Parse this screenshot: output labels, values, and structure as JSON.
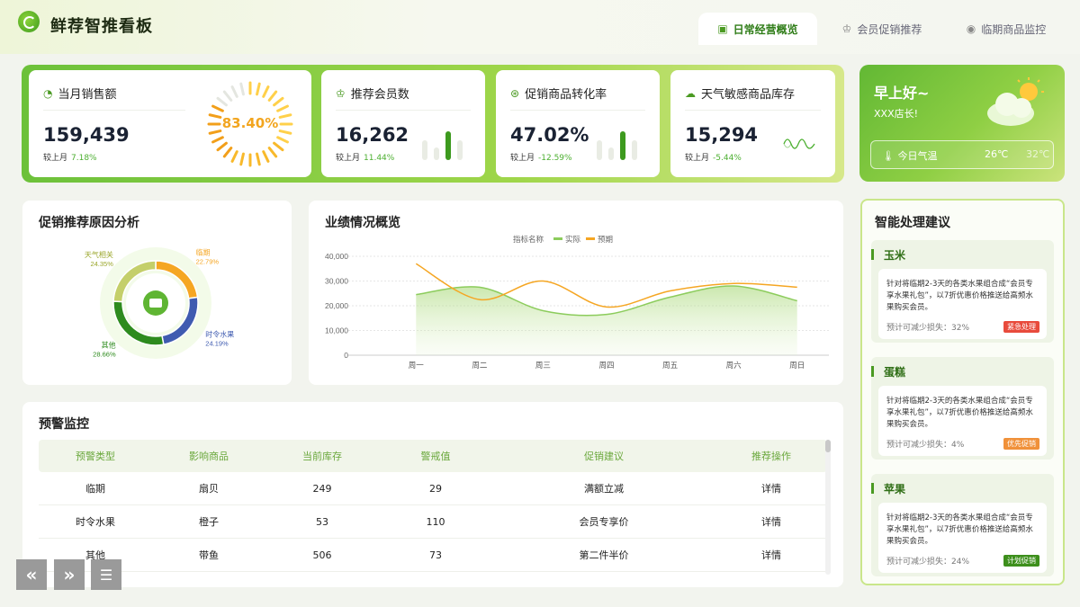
{
  "app": {
    "title": "鲜荐智推看板"
  },
  "tabs": [
    {
      "label": "日常经营概览",
      "icon": "monitor-icon"
    },
    {
      "label": "会员促销推荐",
      "icon": "crown-icon"
    },
    {
      "label": "临期商品监控",
      "icon": "location-icon"
    }
  ],
  "kpis": [
    {
      "title": "当月销售额",
      "icon": "pie-chart-icon",
      "value": "159,439",
      "compare_label": "较上月",
      "compare_value": "7.18%",
      "gauge_percent": 83.4,
      "gauge_label": "83.40%"
    },
    {
      "title": "推荐会员数",
      "icon": "crown-icon",
      "value": "16,262",
      "compare_label": "较上月",
      "compare_value": "11.44%"
    },
    {
      "title": "促销商品转化率",
      "icon": "dollar-circle-icon",
      "value": "47.02%",
      "compare_label": "较上月",
      "compare_value": "-12.59%"
    },
    {
      "title": "天气敏感商品库存",
      "icon": "cloud-icon",
      "value": "15,294",
      "compare_label": "较上月",
      "compare_value": "-5.44%"
    }
  ],
  "weather": {
    "greeting": "早上好~",
    "name": "XXX店长!",
    "today_label": "今日气温",
    "temp_low": "26℃",
    "temp_high": "32℃"
  },
  "reason_panel": {
    "title": "促销推荐原因分析"
  },
  "perf_panel": {
    "title": "业绩情况概览"
  },
  "warning_panel": {
    "title": "预警监控",
    "columns": [
      "预警类型",
      "影响商品",
      "当前库存",
      "警戒值",
      "促销建议",
      "推荐操作"
    ],
    "rows": [
      [
        "临期",
        "扇贝",
        "249",
        "29",
        "满额立减",
        "详情"
      ],
      [
        "时令水果",
        "橙子",
        "53",
        "110",
        "会员专享价",
        "详情"
      ],
      [
        "其他",
        "带鱼",
        "506",
        "73",
        "第二件半价",
        "详情"
      ]
    ]
  },
  "advice_panel": {
    "title": "智能处理建议",
    "items": [
      {
        "name": "玉米",
        "text": "针对将临期2-3天的各类水果组合成“会员专享水果礼包”，以7折优惠价格推送给高频水果购买会员。",
        "foot": "预计可减少损失：32%",
        "badge": "紧急处理",
        "badge_color": "#e84b3c"
      },
      {
        "name": "蛋糕",
        "text": "针对将临期2-3天的各类水果组合成“会员专享水果礼包”，以7折优惠价格推送给高频水果购买会员。",
        "foot": "预计可减少损失：4%",
        "badge": "优先促销",
        "badge_color": "#f0913a"
      },
      {
        "name": "苹果",
        "text": "针对将临期2-3天的各类水果组合成“会员专享水果礼包”，以7折优惠价格推送给高频水果购买会员。",
        "foot": "预计可减少损失：24%",
        "badge": "计划促销",
        "badge_color": "#3d8f1c"
      }
    ]
  },
  "colors": {
    "accent": "#4a9a22",
    "actual": "#8ccc5c",
    "forecast": "#f5a623",
    "gauge": "#f2a51f"
  },
  "chart_data": [
    {
      "type": "pie",
      "title": "",
      "categories": [
        "临期",
        "时令水果",
        "其他",
        "天气相关"
      ],
      "values": [
        22.79,
        24.19,
        28.66,
        24.35
      ],
      "labels": [
        "22.79%",
        "24.19%",
        "28.66%",
        "24.35%"
      ],
      "colors": [
        "#f5a623",
        "#3f5bb0",
        "#2e8b1e",
        "#c4cf6a"
      ]
    },
    {
      "type": "area",
      "title": "",
      "legend_title": "指标名称",
      "categories": [
        "周一",
        "周二",
        "周三",
        "周四",
        "周五",
        "周六",
        "周日"
      ],
      "series": [
        {
          "name": "实际",
          "values": [
            24500,
            27500,
            18000,
            16500,
            23500,
            28000,
            22000
          ]
        },
        {
          "name": "预期",
          "values": [
            37000,
            22500,
            30000,
            19500,
            26000,
            29000,
            27500
          ]
        }
      ],
      "yticks": [
        "0",
        "10,000",
        "20,000",
        "30,000",
        "40,000"
      ],
      "ylim": [
        0,
        40000
      ]
    }
  ]
}
